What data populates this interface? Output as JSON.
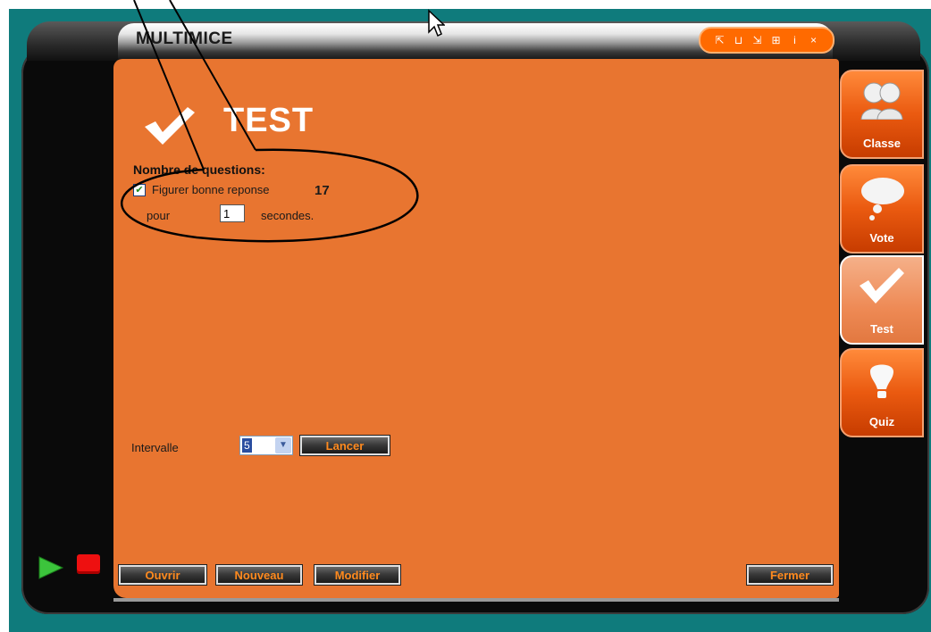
{
  "app": {
    "title": "MULTIMICE",
    "controls": [
      "⇱",
      "⊔",
      "⇲",
      "⊞",
      "i",
      "×"
    ]
  },
  "main": {
    "heading": "TEST",
    "questions_label": "Nombre de questions:",
    "show_answer_checked": true,
    "show_answer_label": "Figurer bonne reponse",
    "question_count": "17",
    "pour_label": "pour",
    "seconds_value": "1",
    "seconds_label": "secondes.",
    "interval_label": "Intervalle",
    "interval_value": "5",
    "launch_button": "Lancer"
  },
  "footer": {
    "open_button": "Ouvrir",
    "new_button": "Nouveau",
    "edit_button": "Modifier",
    "close_button": "Fermer"
  },
  "sidebar": {
    "tabs": [
      {
        "label": "Classe",
        "icon": "users-icon"
      },
      {
        "label": "Vote",
        "icon": "speech-bubble-icon"
      },
      {
        "label": "Test",
        "icon": "checkmark-icon",
        "active": true
      },
      {
        "label": "Quiz",
        "icon": "lightbulb-icon"
      }
    ]
  },
  "colors": {
    "panel": "#e87530",
    "background": "#0f7b7c",
    "button_text": "#ff8a1e"
  }
}
